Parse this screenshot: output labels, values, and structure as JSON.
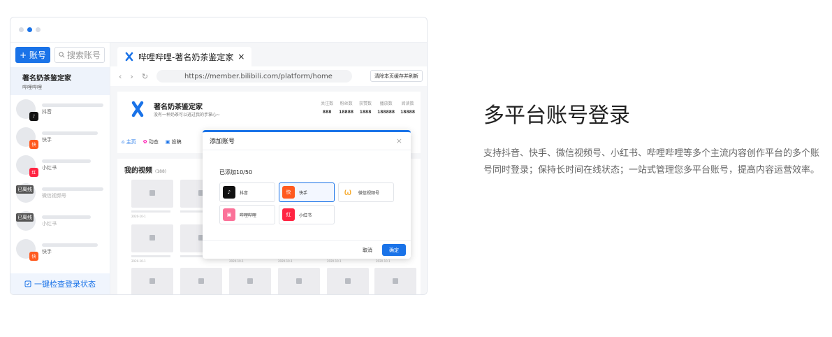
{
  "sidebar": {
    "add_label": "+ 账号",
    "search_placeholder": "搜索账号",
    "accounts": [
      {
        "name": "著名奶茶鉴定家",
        "platform": "哔哩哔哩"
      },
      {
        "platform": "抖音"
      },
      {
        "platform": "快手"
      },
      {
        "platform": "小红书"
      },
      {
        "platform": "微信视频号",
        "status": "已离线"
      },
      {
        "platform": "小红书",
        "status": "已离线"
      },
      {
        "platform": "快手"
      }
    ],
    "bottom_label": "一键检查登录状态"
  },
  "browser": {
    "tab_title": "哔哩哔哩-著名奶茶鉴定家",
    "tab_close": "×",
    "url": "https://member.bilibili.com/platform/home",
    "clear_button": "清除本页缓存并刷新",
    "profile": {
      "name": "著名奶茶鉴定家",
      "desc": "没有一杯奶茶可以逃过我的手掌心~",
      "stats": [
        {
          "label": "关注数",
          "value": "888"
        },
        {
          "label": "粉丝数",
          "value": "18888"
        },
        {
          "label": "获赞数",
          "value": "1888"
        },
        {
          "label": "播放数",
          "value": "188888"
        },
        {
          "label": "阅读数",
          "value": "18888"
        }
      ]
    },
    "nav": [
      "主页",
      "动态",
      "投稿"
    ],
    "videos_title": "我的视频",
    "videos_count": "(188)",
    "video_meta": "2020-10-1"
  },
  "dialog": {
    "title": "添加账号",
    "close": "×",
    "count": "已添加10/50",
    "platforms": [
      {
        "label": "抖音",
        "icon": "douyin-icon",
        "color": "#111111"
      },
      {
        "label": "快手",
        "icon": "kuaishou-icon",
        "color": "#ff5a1f"
      },
      {
        "label": "微信视频号",
        "icon": "wechat-channels-icon",
        "color": "#f6a623"
      },
      {
        "label": "哔哩哔哩",
        "icon": "bilibili-icon",
        "color": "#fb7299"
      },
      {
        "label": "小红书",
        "icon": "xiaohongshu-icon",
        "color": "#ff2442"
      }
    ],
    "cancel": "取消",
    "confirm": "确定"
  },
  "feature": {
    "heading": "多平台账号登录",
    "description": "支持抖音、快手、微信视频号、小红书、哔哩哔哩等多个主流内容创作平台的多个账号同时登录；保持长时间在线状态；一站式管理您多平台账号，提高内容运营效率。"
  },
  "colors": {
    "accent": "#1a73e8"
  }
}
